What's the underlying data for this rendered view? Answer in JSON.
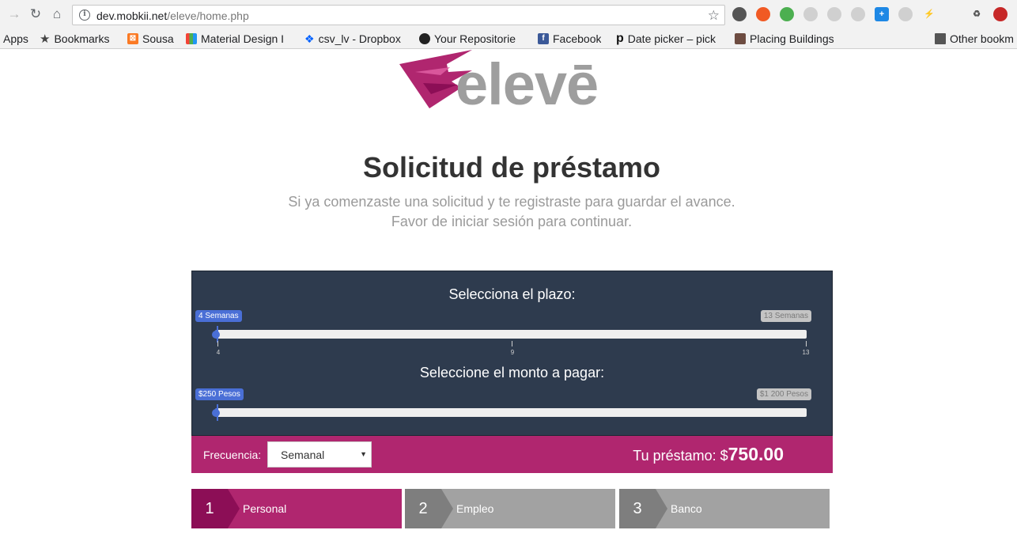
{
  "browser": {
    "url_host": "dev.mobkii.net",
    "url_path": "/eleve/home.php",
    "bookmarks": [
      {
        "label": "Apps",
        "icon": "apps-icon"
      },
      {
        "label": "Bookmarks",
        "icon": "star-icon"
      },
      {
        "label": "Sousa",
        "icon": "xampp-icon"
      },
      {
        "label": "Material Design I",
        "icon": "material-icon"
      },
      {
        "label": "csv_lv - Dropbox",
        "icon": "dropbox-icon"
      },
      {
        "label": "Your Repositorie",
        "icon": "github-icon"
      },
      {
        "label": "Facebook",
        "icon": "facebook-icon"
      },
      {
        "label": "Date picker – pick",
        "icon": "p-icon"
      },
      {
        "label": "Placing Buildings",
        "icon": "buildings-icon"
      },
      {
        "label": "Other bookm",
        "icon": "folder-icon"
      }
    ]
  },
  "logo": {
    "text": "elevē",
    "colors": {
      "pink": "#b0266f",
      "grey": "#9e9e9e"
    }
  },
  "header": {
    "title": "Solicitud de préstamo",
    "subtitle_line1": "Si ya comenzaste una solicitud y te registraste para guardar el avance.",
    "subtitle_line2": "Favor de iniciar sesión para continuar."
  },
  "term_slider": {
    "heading": "Selecciona el plazo:",
    "min_label": "4 Semanas",
    "max_label": "13 Semanas",
    "min": 4,
    "max": 13,
    "value": 4,
    "ticks": [
      "4",
      "9",
      "13"
    ]
  },
  "amount_slider": {
    "heading": "Seleccione el monto a pagar:",
    "min_label": "$250 Pesos",
    "max_label": "$1 200 Pesos",
    "min": 250,
    "max": 1200,
    "value": 250
  },
  "frequency": {
    "label": "Frecuencia:",
    "selected": "Semanal"
  },
  "loan": {
    "label": "Tu préstamo: ",
    "currency": "$",
    "amount": "750.00"
  },
  "steps": [
    {
      "number": "1",
      "name": "Personal",
      "active": true
    },
    {
      "number": "2",
      "name": "Empleo",
      "active": false
    },
    {
      "number": "3",
      "name": "Banco",
      "active": false
    }
  ],
  "colors": {
    "accent": "#b0266f",
    "panel": "#2e3b4e",
    "slider": "#4a6fd6"
  }
}
